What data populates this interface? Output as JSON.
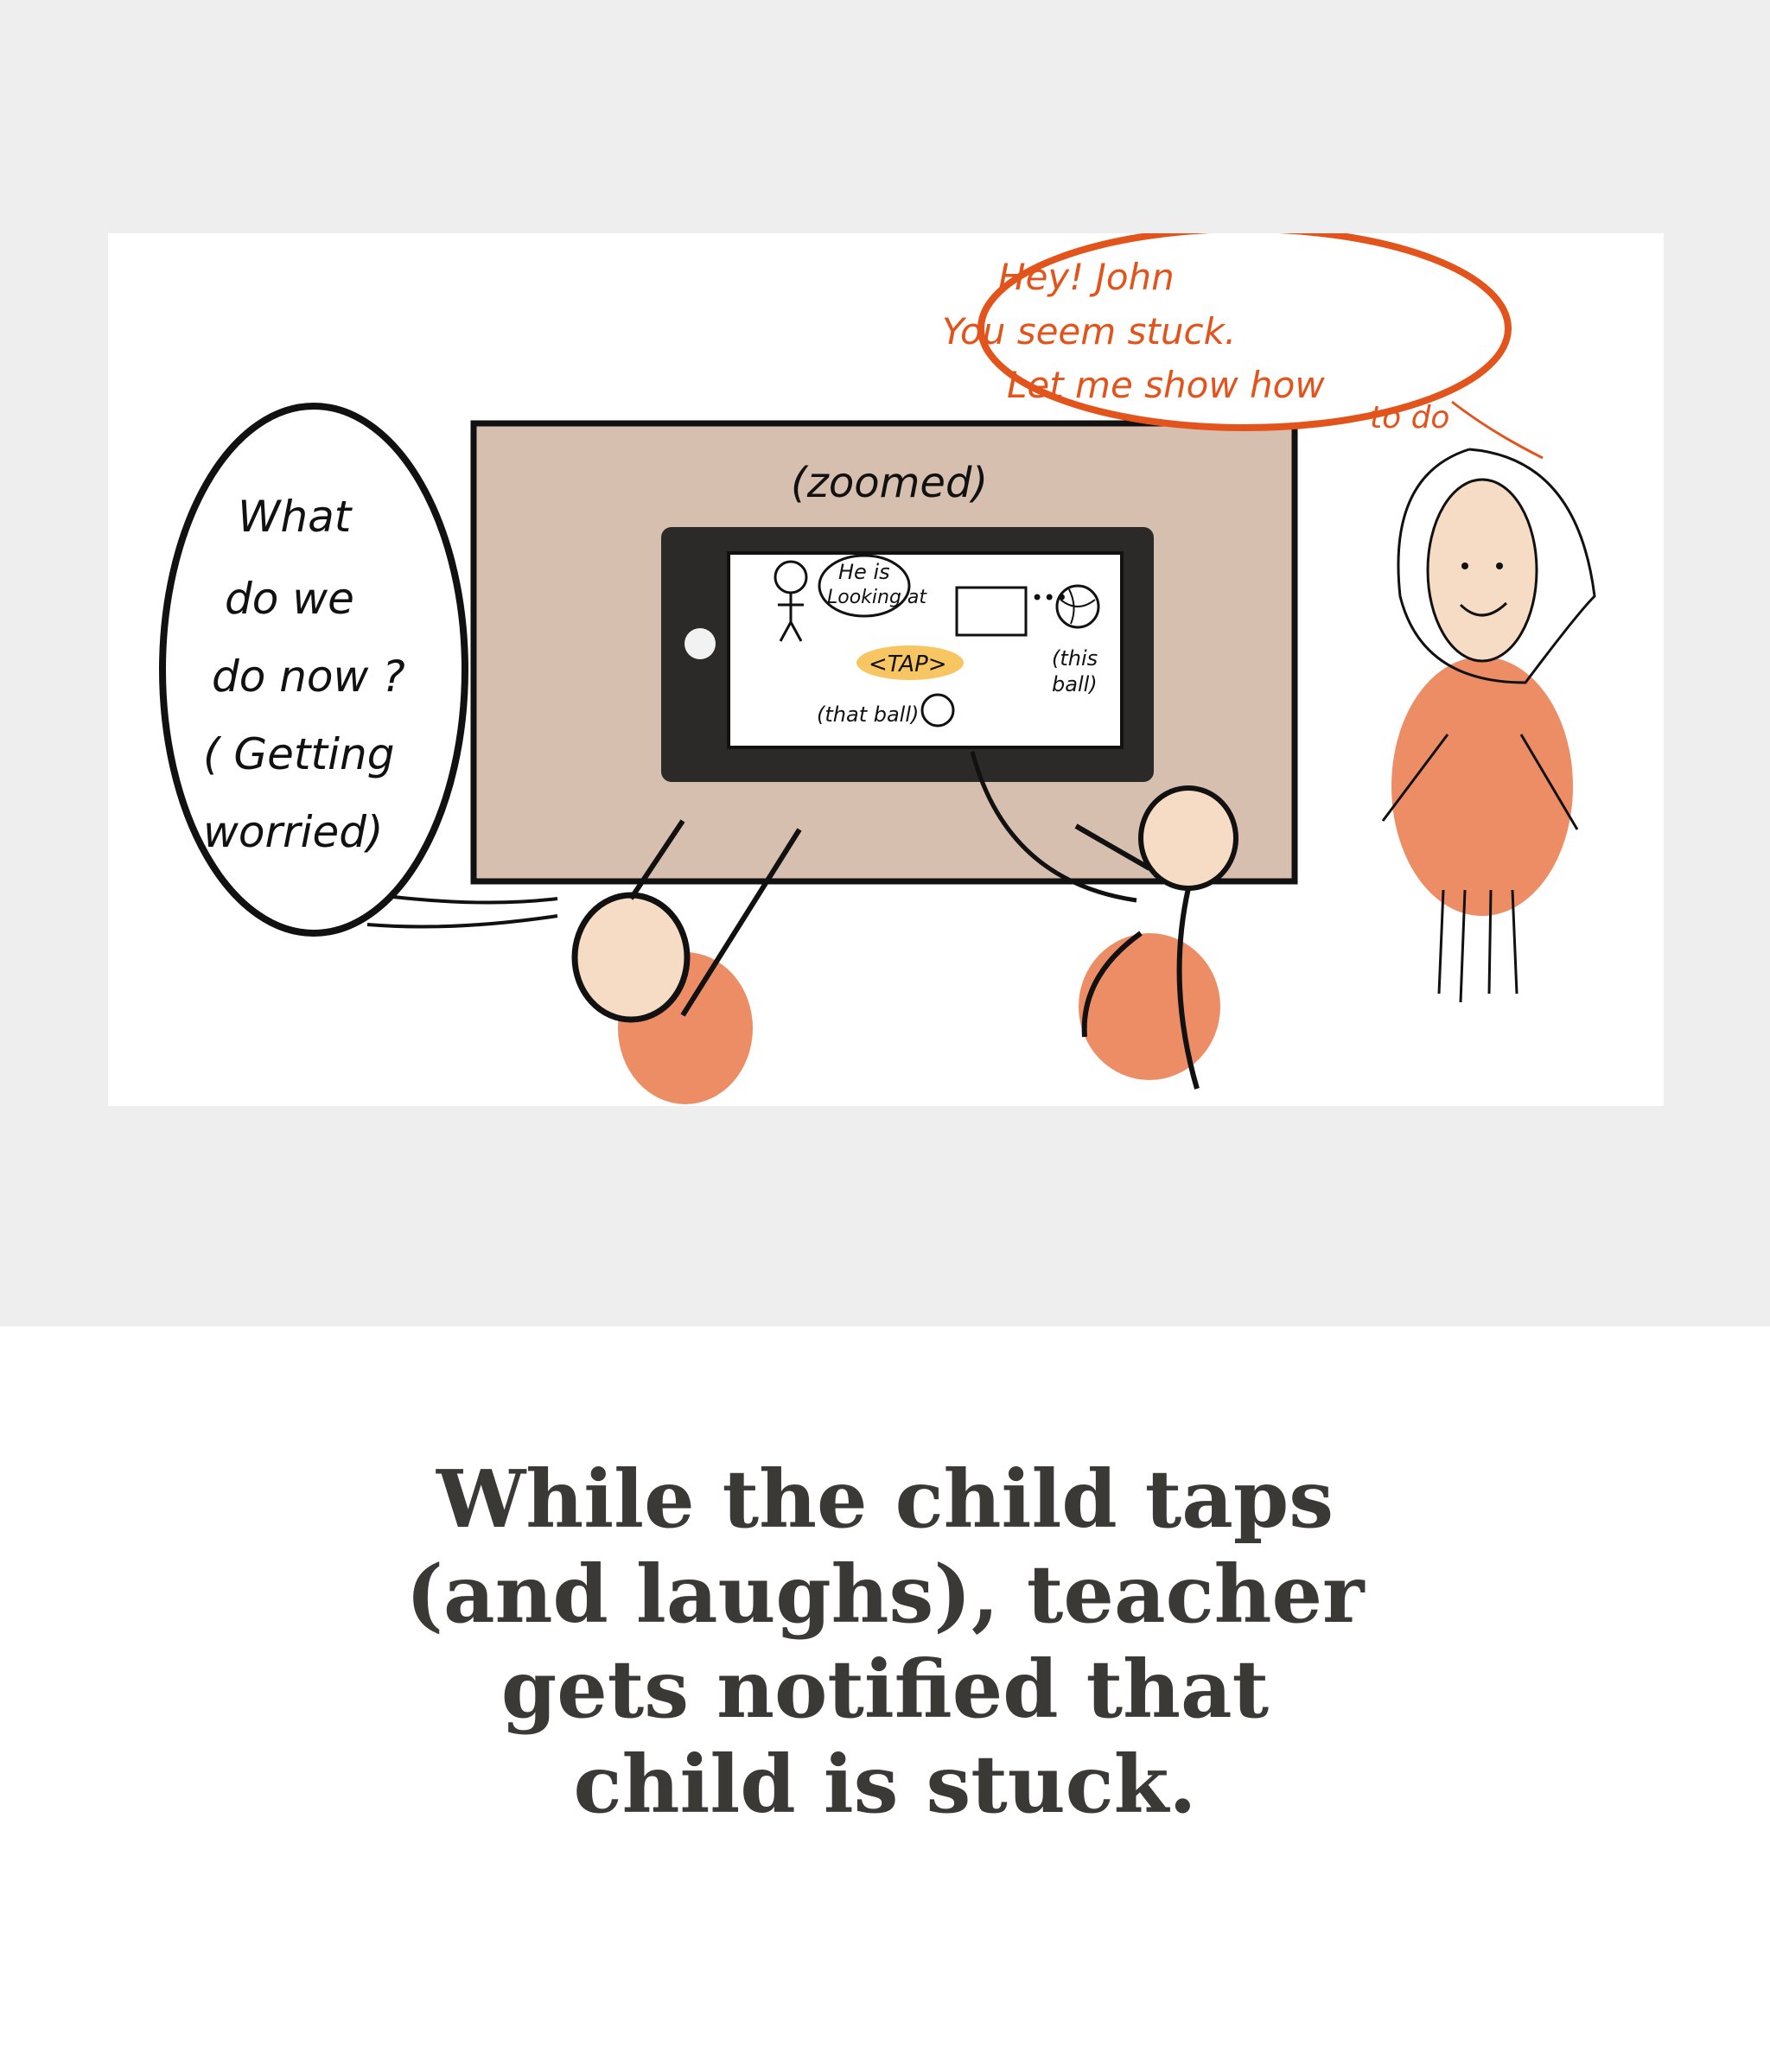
{
  "illustration": {
    "zoom_note": "(zoomed)",
    "child_bubble_lines": [
      "What",
      "do we",
      "do now ?",
      "( Getting",
      "worried)"
    ],
    "teacher_bubble_lines": [
      "Hey! John",
      "You seem stuck.",
      "Let me show how",
      "to do"
    ],
    "screen_bubble_lines": [
      "He is",
      "Looking at"
    ],
    "tap_label": "<TAP>",
    "this_ball_lines": [
      "(this",
      "ball)"
    ],
    "that_ball": "(that ball)"
  },
  "caption_lines": [
    "While the child taps",
    "(and laughs), teacher",
    "gets notified that",
    "child is stuck."
  ],
  "colors": {
    "band": "#eeeeee",
    "desk": "#d6bfae",
    "accent_orange": "#e2541b",
    "skin": "#f6dcc4",
    "tap_highlight": "#f6b73c",
    "caption_text": "#3b3935"
  }
}
